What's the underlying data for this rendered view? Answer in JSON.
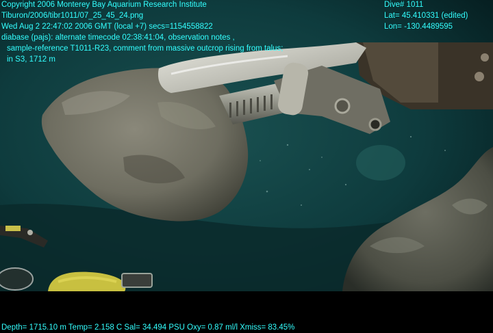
{
  "overlay": {
    "copyright": "Copyright 2006 Monterey Bay Aquarium Research Institute",
    "file_path": "Tiburon/2006/tibr1011/07_25_45_24.png",
    "datetime": "Wed Aug  2 22:47:02 2006 GMT (local +7)  secs=1154558822",
    "notes_line1": "diabase (pajs): alternate timecode 02:38:41:04, observation notes ,",
    "notes_line2": "sample-reference T1011-R23, comment from massive outcrop rising from talus;",
    "notes_line3": "in S3, 1712 m",
    "dive": "Dive# 1011",
    "lat": "Lat= 45.410331 (edited)",
    "lon": "Lon= -130.4489595",
    "telemetry": "Depth= 1715.10 m  Temp= 2.158 C  Sal= 34.494 PSU  Oxy= 0.87 ml/l  Xmiss= 83.45%"
  },
  "colors": {
    "overlay_text": "#33ffff",
    "water": "#0d3a3a",
    "rock": "#77766a",
    "manipulator": "#a9aaa0"
  }
}
